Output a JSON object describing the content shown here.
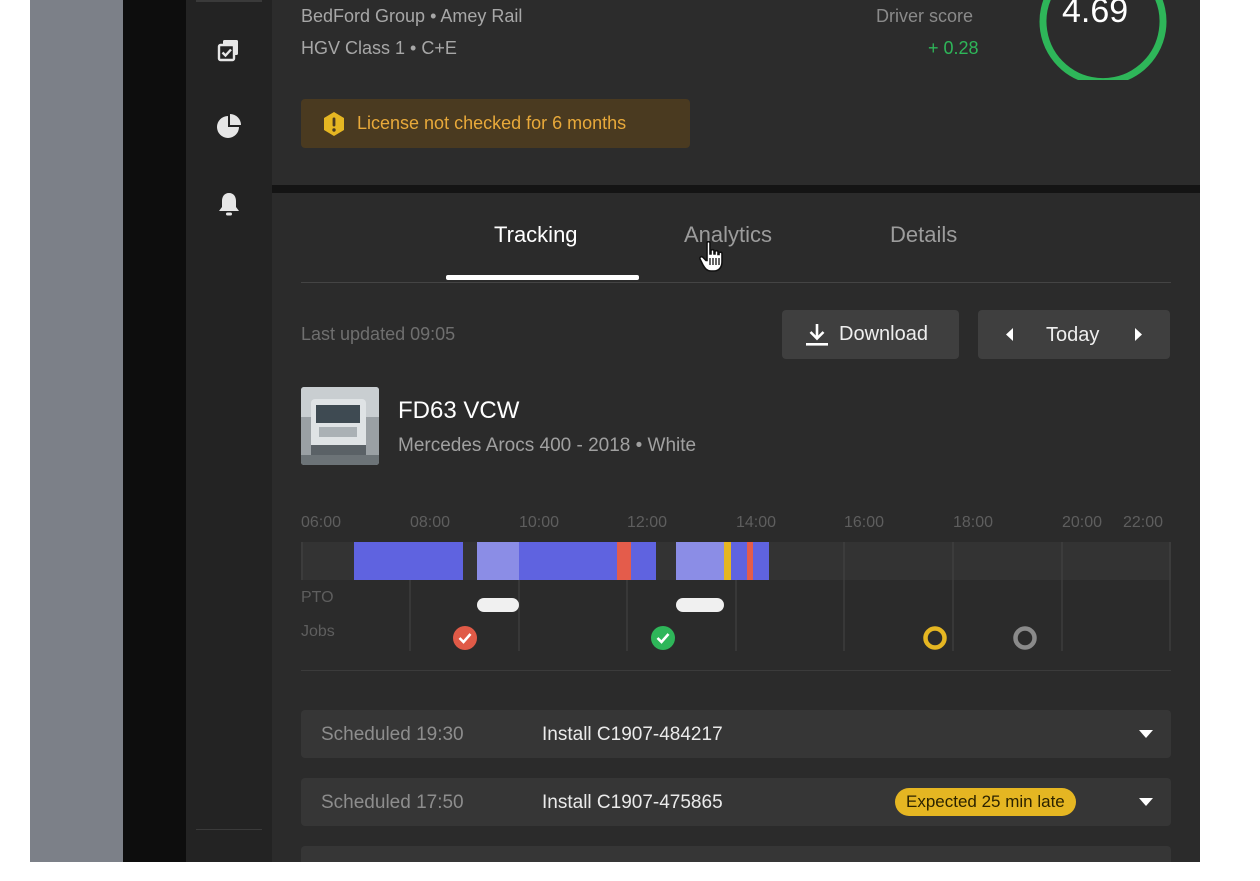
{
  "sidebar": {
    "icons": [
      "copy-check-icon",
      "pie-chart-icon",
      "bell-icon"
    ]
  },
  "profile": {
    "company_line": "BedFord Group  •  Amey Rail",
    "license_line": "HGV Class 1  •  C+E",
    "score_label": "Driver score",
    "score_delta": "+ 0.28",
    "score_value": "4.69",
    "warning_text": "License not checked for 6 months",
    "colors": {
      "score_ring": "#2eb659",
      "warning": "#e8a93a"
    }
  },
  "tabs": [
    {
      "label": "Tracking",
      "active": true
    },
    {
      "label": "Analytics",
      "active": false
    },
    {
      "label": "Details",
      "active": false
    }
  ],
  "tracking": {
    "last_updated": "Last updated 09:05",
    "download_label": "Download",
    "date_label": "Today"
  },
  "vehicle": {
    "registration": "FD63 VCW",
    "description": "Mercedes Arocs 400 - 2018  •  White"
  },
  "timeline": {
    "ticks": [
      "06:00",
      "08:00",
      "10:00",
      "12:00",
      "14:00",
      "16:00",
      "18:00",
      "20:00",
      "22:00"
    ],
    "row_labels": [
      "PTO",
      "Jobs"
    ],
    "job_markers": [
      {
        "time": "08:40",
        "status": "completed-late",
        "color": "#e05a47"
      },
      {
        "time": "12:40",
        "status": "completed",
        "color": "#2eb659"
      },
      {
        "time": "17:40",
        "status": "pending",
        "color": "#e5b622"
      },
      {
        "time": "19:20",
        "status": "scheduled",
        "color": "#8a8a8a"
      }
    ]
  },
  "jobs": [
    {
      "scheduled": "Scheduled 19:30",
      "name": "Install C1907-484217",
      "badge": ""
    },
    {
      "scheduled": "Scheduled 17:50",
      "name": "Install C1907-475865",
      "badge": "Expected 25 min late"
    }
  ]
}
